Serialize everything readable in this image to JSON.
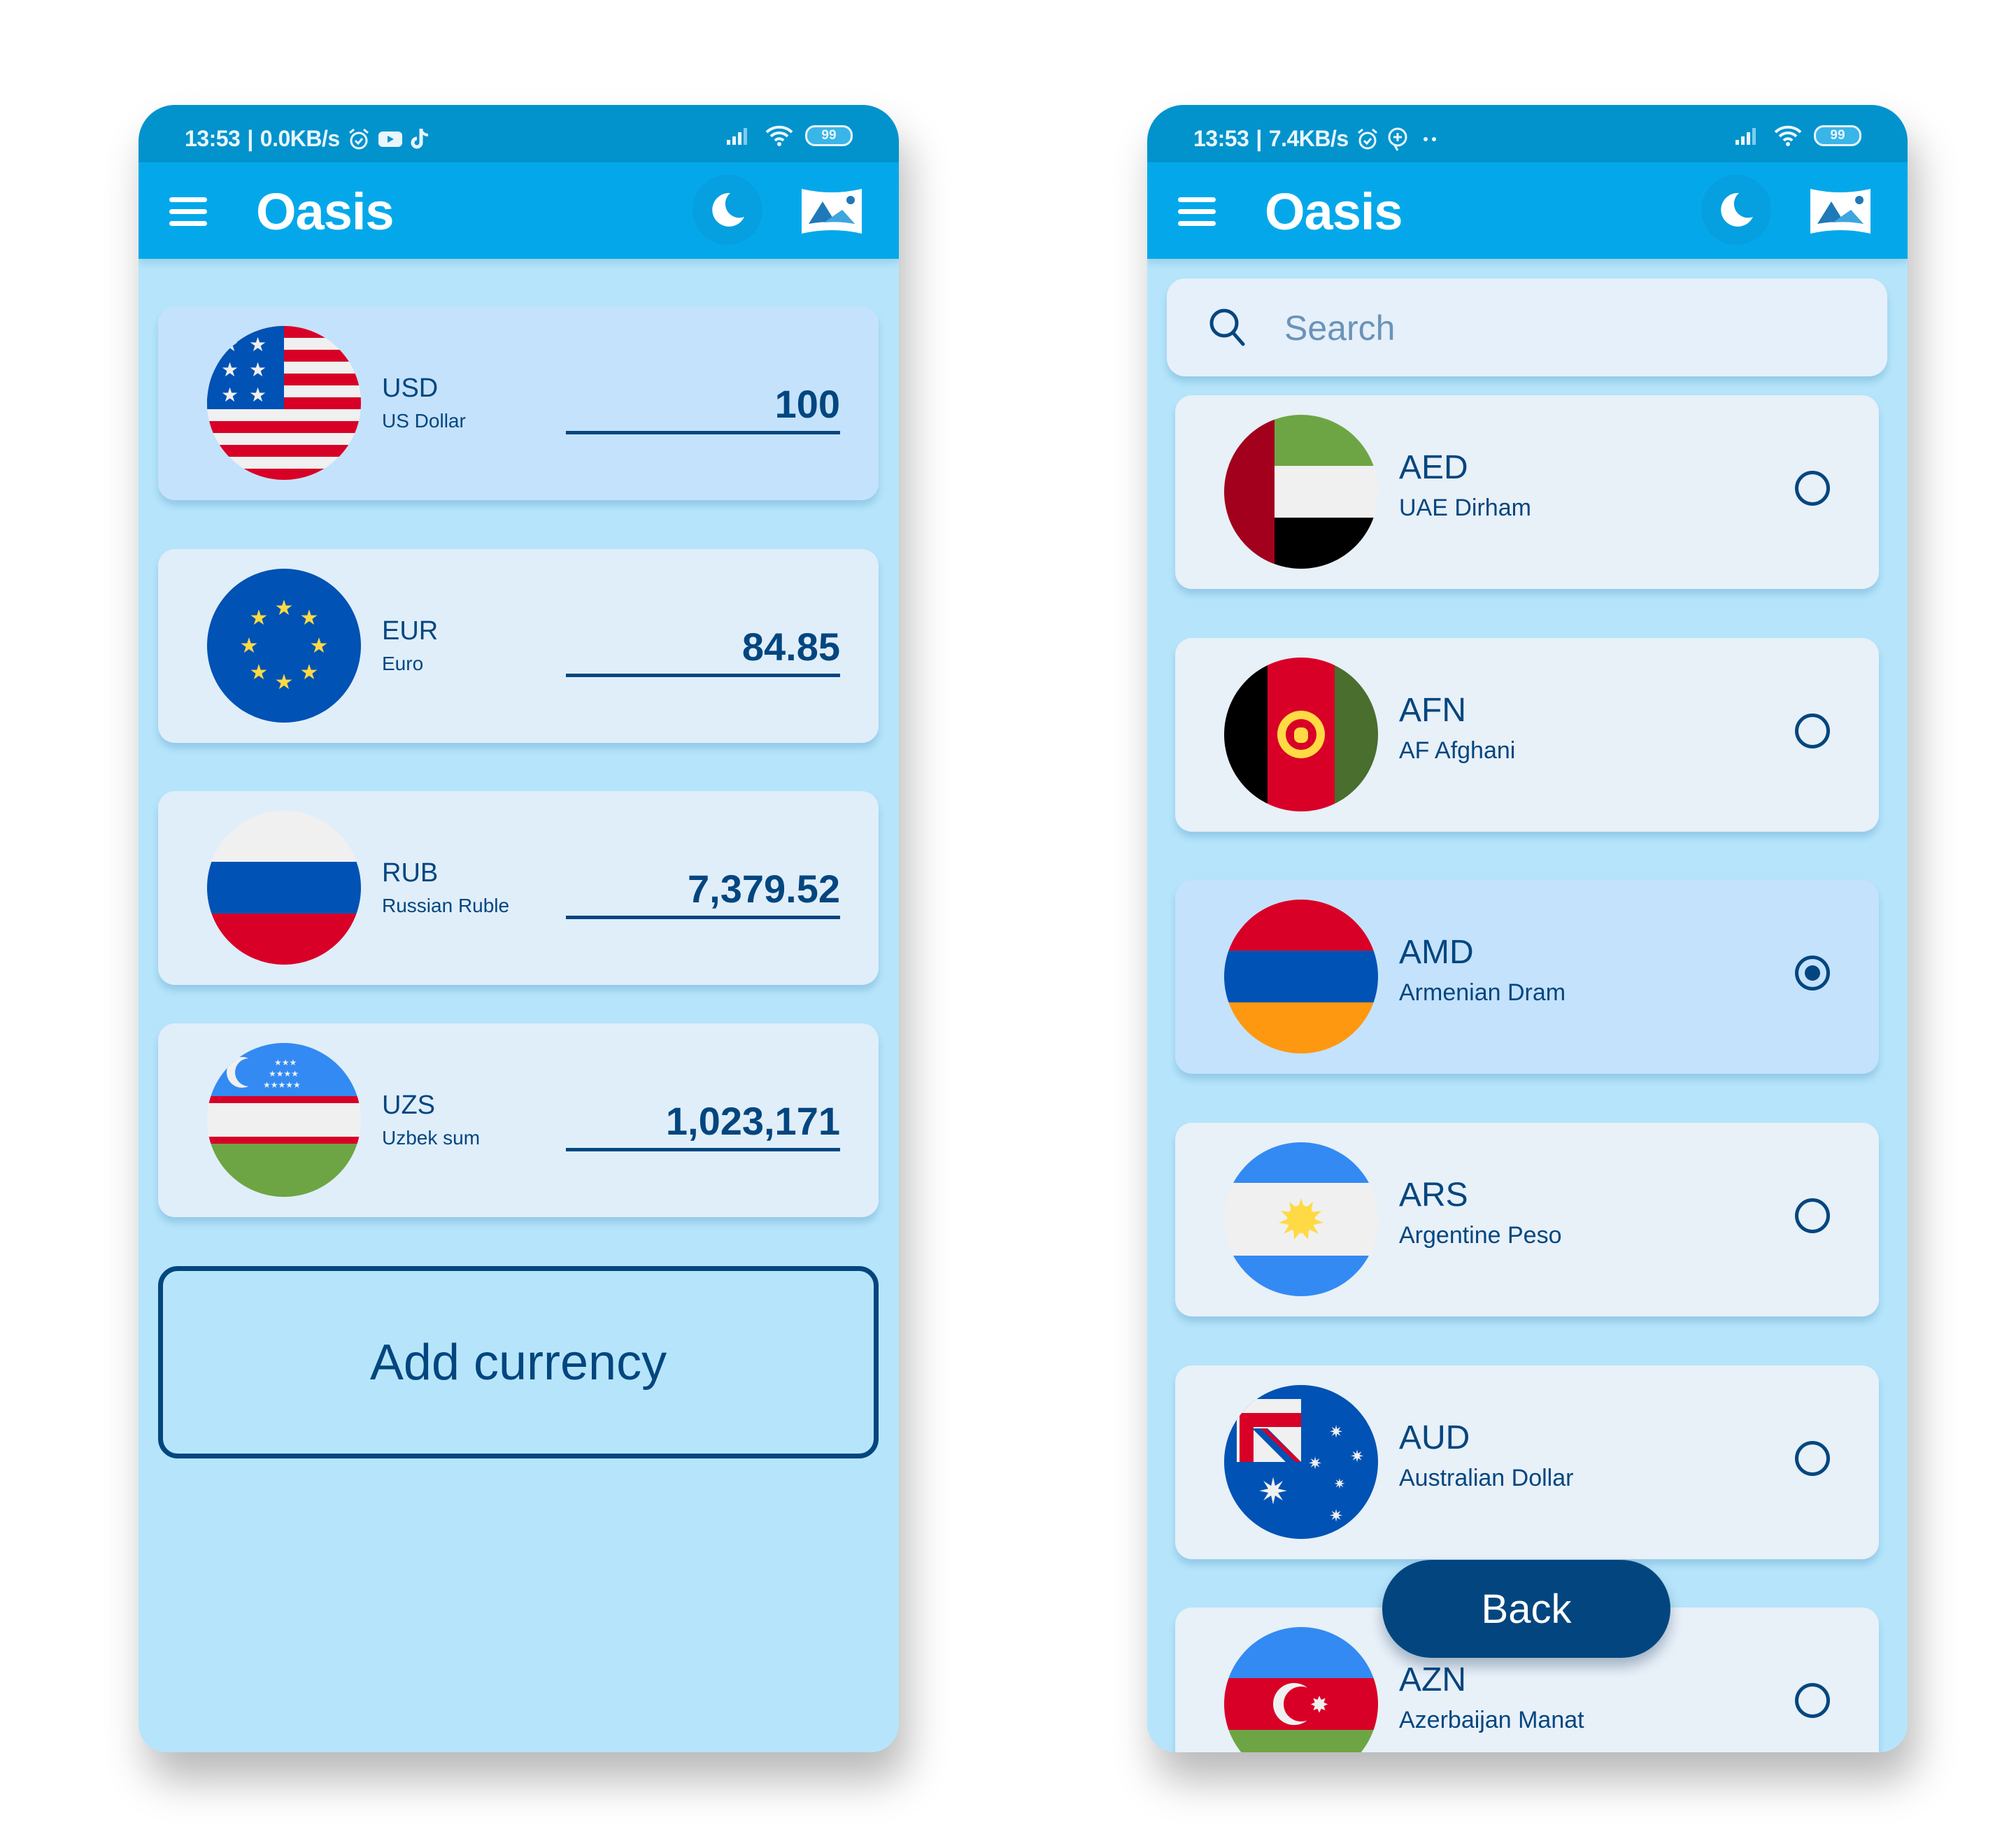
{
  "colors": {
    "status_bar": "#0293cc",
    "app_bar": "#04a8ea",
    "background": "#b6e5fb",
    "card": "#e0eefa",
    "card_selected": "#c4e2fc",
    "primary_text": "#03467f"
  },
  "left_screen": {
    "status_bar": {
      "time": "13:53",
      "speed": "0.0KB/s",
      "icons": [
        "alarm-icon",
        "youtube-icon",
        "tiktok-icon"
      ],
      "right_icons": [
        "signal-icon",
        "wifi-icon"
      ],
      "battery": "99"
    },
    "app_bar": {
      "menu_icon": "hamburger-menu-icon",
      "title": "Oasis",
      "theme_icon": "moon-icon",
      "wallpaper_icon": "landscape-image-icon"
    },
    "currencies": [
      {
        "code": "USD",
        "name": "US Dollar",
        "amount": "100",
        "flag": "us-flag",
        "selected": true
      },
      {
        "code": "EUR",
        "name": "Euro",
        "amount": "84.85",
        "flag": "eu-flag",
        "selected": false
      },
      {
        "code": "RUB",
        "name": "Russian Ruble",
        "amount": "7,379.52",
        "flag": "ru-flag",
        "selected": false
      },
      {
        "code": "UZS",
        "name": "Uzbek sum",
        "amount": "1,023,171",
        "flag": "uz-flag",
        "selected": false
      }
    ],
    "add_button_label": "Add currency"
  },
  "right_screen": {
    "status_bar": {
      "time": "13:53",
      "speed": "7.4KB/s",
      "icons": [
        "alarm-icon",
        "chat-plus-icon",
        "more-dots-icon"
      ],
      "right_icons": [
        "signal-icon",
        "wifi-icon"
      ],
      "battery": "99"
    },
    "app_bar": {
      "menu_icon": "hamburger-menu-icon",
      "title": "Oasis",
      "theme_icon": "moon-icon",
      "wallpaper_icon": "landscape-image-icon"
    },
    "search": {
      "placeholder": "Search",
      "value": ""
    },
    "currency_list": [
      {
        "code": "AED",
        "name": "UAE Dirham",
        "flag": "ae-flag",
        "selected": false
      },
      {
        "code": "AFN",
        "name": "AF Afghani",
        "flag": "af-flag",
        "selected": false
      },
      {
        "code": "AMD",
        "name": "Armenian Dram",
        "flag": "am-flag",
        "selected": true
      },
      {
        "code": "ARS",
        "name": "Argentine Peso",
        "flag": "ar-flag",
        "selected": false
      },
      {
        "code": "AUD",
        "name": "Australian Dollar",
        "flag": "au-flag",
        "selected": false
      },
      {
        "code": "AZN",
        "name": "Azerbaijan Manat",
        "flag": "az-flag",
        "selected": false
      }
    ],
    "back_button_label": "Back"
  }
}
